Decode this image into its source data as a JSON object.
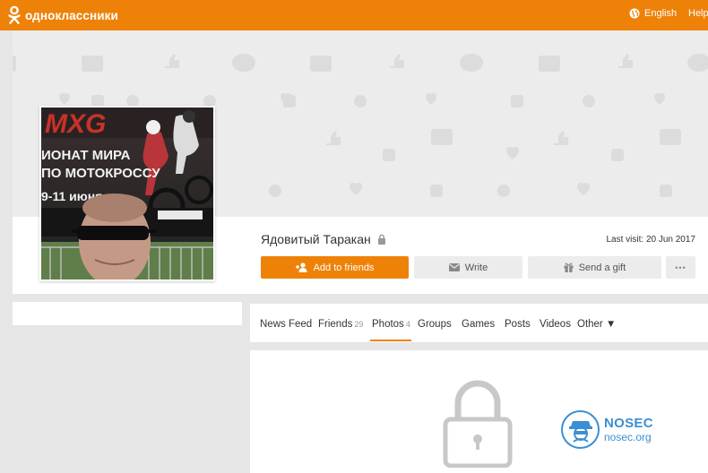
{
  "header": {
    "logo_text": "одноклассники",
    "language": "English",
    "help": "Help"
  },
  "profile": {
    "name": "Ядовитый Таракан",
    "last_visit": "Last visit: 20 Jun 2017",
    "buttons": {
      "add_friends": "Add to friends",
      "write": "Write",
      "gift": "Send a gift",
      "more": "•••"
    },
    "avatar_poster": {
      "line1": "ИОНАТ МИРА",
      "line2": "ПО МОТОКРОССУ",
      "line3": "9-11 июня"
    }
  },
  "nav": {
    "tabs": [
      {
        "label": "News Feed",
        "count": ""
      },
      {
        "label": "Friends",
        "count": "29"
      },
      {
        "label": "Photos",
        "count": "4"
      },
      {
        "label": "Groups",
        "count": ""
      },
      {
        "label": "Games",
        "count": ""
      },
      {
        "label": "Posts",
        "count": ""
      },
      {
        "label": "Videos",
        "count": ""
      },
      {
        "label": "Other ▼",
        "count": ""
      }
    ],
    "active": "Photos"
  },
  "watermark": {
    "title": "NOSEC",
    "subtitle": "nosec.org"
  },
  "colors": {
    "brand": "#ee8208",
    "watermark": "#3b8fd4"
  }
}
